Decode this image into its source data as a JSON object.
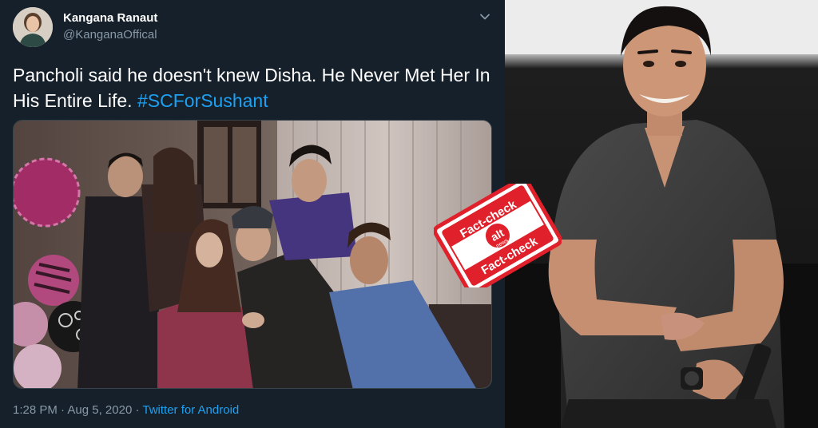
{
  "tweet": {
    "author_name": "Kangana Ranaut",
    "author_handle": "@KanganaOffical",
    "text_main": "Pancholi said he doesn't knew Disha. He Never Met Her In His Entire Life. ",
    "hashtag": "#SCForSushant",
    "time": "1:28 PM",
    "date": "Aug 5, 2020",
    "separator": " · ",
    "source": "Twitter for Android",
    "icons": {
      "avatar": "avatar-photo",
      "menu": "chevron-down-icon"
    }
  },
  "stamp": {
    "top_text": "Fact-check",
    "logo_main": "alt",
    "logo_sub": "news",
    "bottom_text": "Fact-check",
    "color": "#e0202a"
  },
  "colors": {
    "tweet_bg": "#15202b",
    "link": "#1da1f2",
    "muted": "#8899a6",
    "stamp_red": "#e0202a"
  }
}
